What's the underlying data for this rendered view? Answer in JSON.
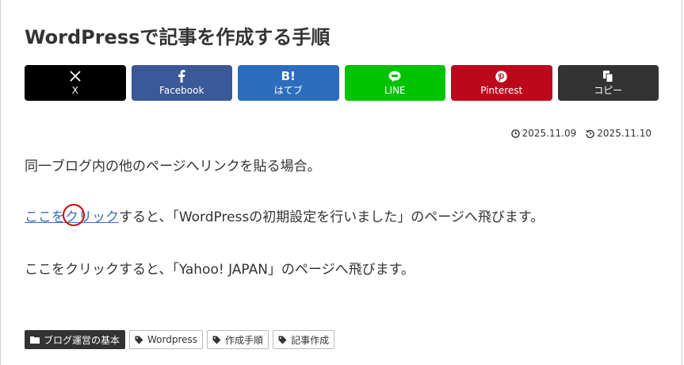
{
  "article": {
    "title": "WordPressで記事を作成する手順",
    "published": "2025.11.09",
    "updated": "2025.11.10"
  },
  "share_buttons": [
    {
      "label": "X",
      "icon": "x-logo-icon",
      "color": "#000000"
    },
    {
      "label": "Facebook",
      "icon": "facebook-icon",
      "color": "#3b5998"
    },
    {
      "label": "はてブ",
      "icon": "hatebu-icon",
      "icon_text": "B!",
      "color": "#2c6ebd"
    },
    {
      "label": "LINE",
      "icon": "line-icon",
      "color": "#00c300"
    },
    {
      "label": "Pinterest",
      "icon": "pinterest-icon",
      "color": "#bd081c"
    },
    {
      "label": "コピー",
      "icon": "copy-icon",
      "color": "#333333"
    }
  ],
  "body": {
    "para1": "同一ブログ内の他のページへリンクを貼る場合。",
    "para2_link": "ここをクリック",
    "para2_rest": "すると、「WordPressの初期設定を行いました」のページへ飛びます。",
    "para3": "ここをクリックすると、「Yahoo! JAPAN」のページへ飛びます。"
  },
  "tags": {
    "category": "ブログ運営の基本",
    "items": [
      "Wordpress",
      "作成手順",
      "記事作成"
    ]
  }
}
